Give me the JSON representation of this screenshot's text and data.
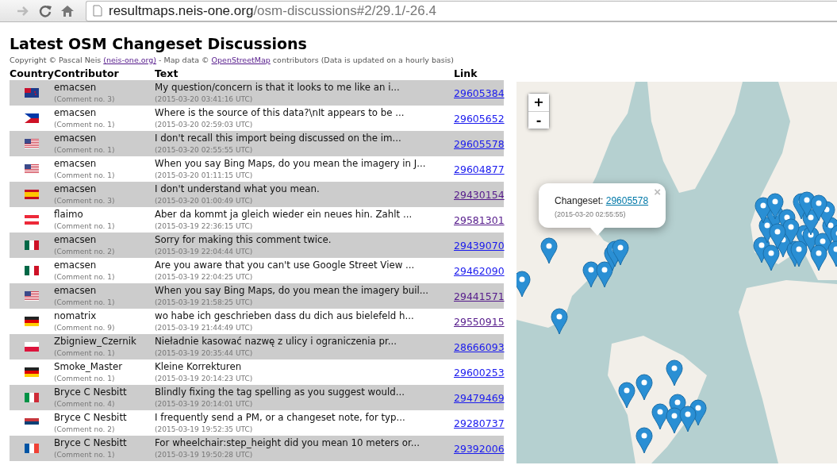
{
  "browser": {
    "url_host": "resultmaps.neis-one.org",
    "url_path": "/osm-discussions#2/29.1/-26.4"
  },
  "title": "Latest OSM Changeset Discussions",
  "credits": [
    {
      "kind": "text",
      "text": "Copyright © Pascal Neis "
    },
    {
      "kind": "link",
      "text": "(neis-one.org)"
    },
    {
      "kind": "text",
      "text": " - Map data © "
    },
    {
      "kind": "link",
      "text": "OpenStreetMap"
    },
    {
      "kind": "text",
      "text": " contributors (Data is updated on a hourly basis)"
    }
  ],
  "table": {
    "columns": [
      "Country",
      "Contributor",
      "Text",
      "Link"
    ],
    "rows": [
      {
        "flag": {
          "kind": "nz"
        },
        "contributor": "emacsen",
        "comment_no": "(Comment no. 3)",
        "text": "My question/concern is that it looks to me like an i...",
        "time": "(2015-03-20 03:41:16 UTC)",
        "link": "29605384",
        "visited": false
      },
      {
        "flag": {
          "kind": "ph"
        },
        "contributor": "emacsen",
        "comment_no": "(Comment no. 1)",
        "text": "Where is the source of this data?\\nIt appears to be ...",
        "time": "(2015-03-20 02:59:03 UTC)",
        "link": "29605652",
        "visited": false
      },
      {
        "flag": {
          "kind": "us"
        },
        "contributor": "emacsen",
        "comment_no": "(Comment no. 1)",
        "text": "I don't recall this import being discussed on the im...",
        "time": "(2015-03-20 02:55:55 UTC)",
        "link": "29605578",
        "visited": false
      },
      {
        "flag": {
          "kind": "us"
        },
        "contributor": "emacsen",
        "comment_no": "(Comment no. 1)",
        "text": "When you say Bing Maps, do you mean the imagery in J...",
        "time": "(2015-03-20 01:11:15 UTC)",
        "link": "29604877",
        "visited": false
      },
      {
        "flag": {
          "kind": "es"
        },
        "contributor": "emacsen",
        "comment_no": "(Comment no. 3)",
        "text": "I don't understand what you mean.",
        "time": "(2015-03-20 01:00:49 UTC)",
        "link": "29430154",
        "visited": true
      },
      {
        "flag": {
          "kind": "at"
        },
        "contributor": "flaimo",
        "comment_no": "(Comment no. 1)",
        "text": "Aber da kommt ja gleich wieder ein neues hin. Zahlt ...",
        "time": "(2015-03-19 22:36:15 UTC)",
        "link": "29581301",
        "visited": true
      },
      {
        "flag": {
          "kind": "mx"
        },
        "contributor": "emacsen",
        "comment_no": "(Comment no. 2)",
        "text": "Sorry for making this comment twice.",
        "time": "(2015-03-19 22:04:44 UTC)",
        "link": "29439070",
        "visited": false
      },
      {
        "flag": {
          "kind": "mx"
        },
        "contributor": "emacsen",
        "comment_no": "(Comment no. 1)",
        "text": "Are you aware that you can't use Google Street View ...",
        "time": "(2015-03-19 22:04:25 UTC)",
        "link": "29462090",
        "visited": false
      },
      {
        "flag": {
          "kind": "us"
        },
        "contributor": "emacsen",
        "comment_no": "(Comment no. 1)",
        "text": "When you say Bing Maps, do you mean the imagery buil...",
        "time": "(2015-03-19 21:58:25 UTC)",
        "link": "29441571",
        "visited": true
      },
      {
        "flag": {
          "kind": "de"
        },
        "contributor": "nomatrix",
        "comment_no": "(Comment no. 9)",
        "text": "wo habe ich geschrieben dass du dich aus bielefeld h...",
        "time": "(2015-03-19 21:44:49 UTC)",
        "link": "29550915",
        "visited": true
      },
      {
        "flag": {
          "kind": "pl"
        },
        "contributor": "Zbigniew_Czernik",
        "comment_no": "(Comment no. 1)",
        "text": "Nieładnie kasować nazwę z ulicy i ograniczenia pr...",
        "time": "(2015-03-19 20:35:44 UTC)",
        "link": "28666093",
        "visited": false
      },
      {
        "flag": {
          "kind": "de"
        },
        "contributor": "Smoke_Master",
        "comment_no": "(Comment no. 1)",
        "text": "Kleine Korrekturen",
        "time": "(2015-03-19 20:14:23 UTC)",
        "link": "29600253",
        "visited": false
      },
      {
        "flag": {
          "kind": "it"
        },
        "contributor": "Bryce C Nesbitt",
        "comment_no": "(Comment no. 4)",
        "text": "Blindly fixing the tag spelling as you suggest would...",
        "time": "(2015-03-19 20:14:01 UTC)",
        "link": "29479469",
        "visited": false
      },
      {
        "flag": {
          "kind": "rs"
        },
        "contributor": "Bryce C Nesbitt",
        "comment_no": "(Comment no. 2)",
        "text": "I frequently send a PM, or a changeset note, for typ...",
        "time": "(2015-03-19 19:52:35 UTC)",
        "link": "29280737",
        "visited": false
      },
      {
        "flag": {
          "kind": "fr"
        },
        "contributor": "Bryce C Nesbitt",
        "comment_no": "(Comment no. 1)",
        "text": "For wheelchair:step_height did you mean 10 meters or...",
        "time": "(2015-03-19 19:50:28 UTC)",
        "link": "29392006",
        "visited": false
      }
    ]
  },
  "map": {
    "zoom_in": "+",
    "zoom_out": "-",
    "popup": {
      "label": "Changeset: ",
      "link": "29605578",
      "time": "(2015-03-20 02:55:55)",
      "close": "×"
    }
  }
}
